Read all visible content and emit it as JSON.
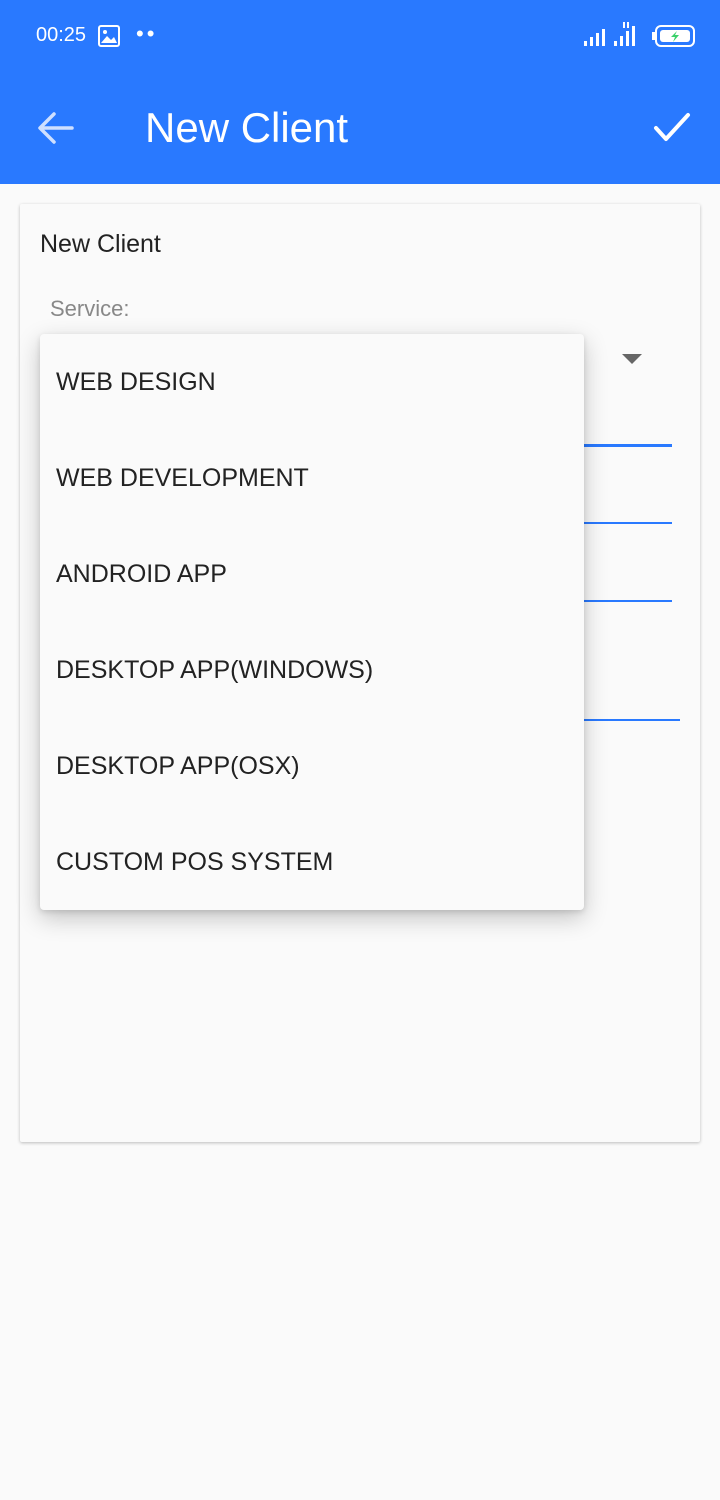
{
  "status_bar": {
    "time": "00:25",
    "dots": "••",
    "icons": [
      "image-icon",
      "signal-icon",
      "signal-icon",
      "battery-charging-icon"
    ]
  },
  "app_bar": {
    "title": "New Client",
    "back_icon": "arrow-back-icon",
    "confirm_icon": "check-icon",
    "color": "#2979ff"
  },
  "form": {
    "card_title": "New Client",
    "service_label": "Service:",
    "accent_color": "#2979ff"
  },
  "service_dropdown": {
    "options": [
      "WEB DESIGN",
      "WEB DEVELOPMENT",
      "ANDROID APP",
      "DESKTOP APP(WINDOWS)",
      "DESKTOP APP(OSX)",
      "CUSTOM POS SYSTEM"
    ]
  }
}
